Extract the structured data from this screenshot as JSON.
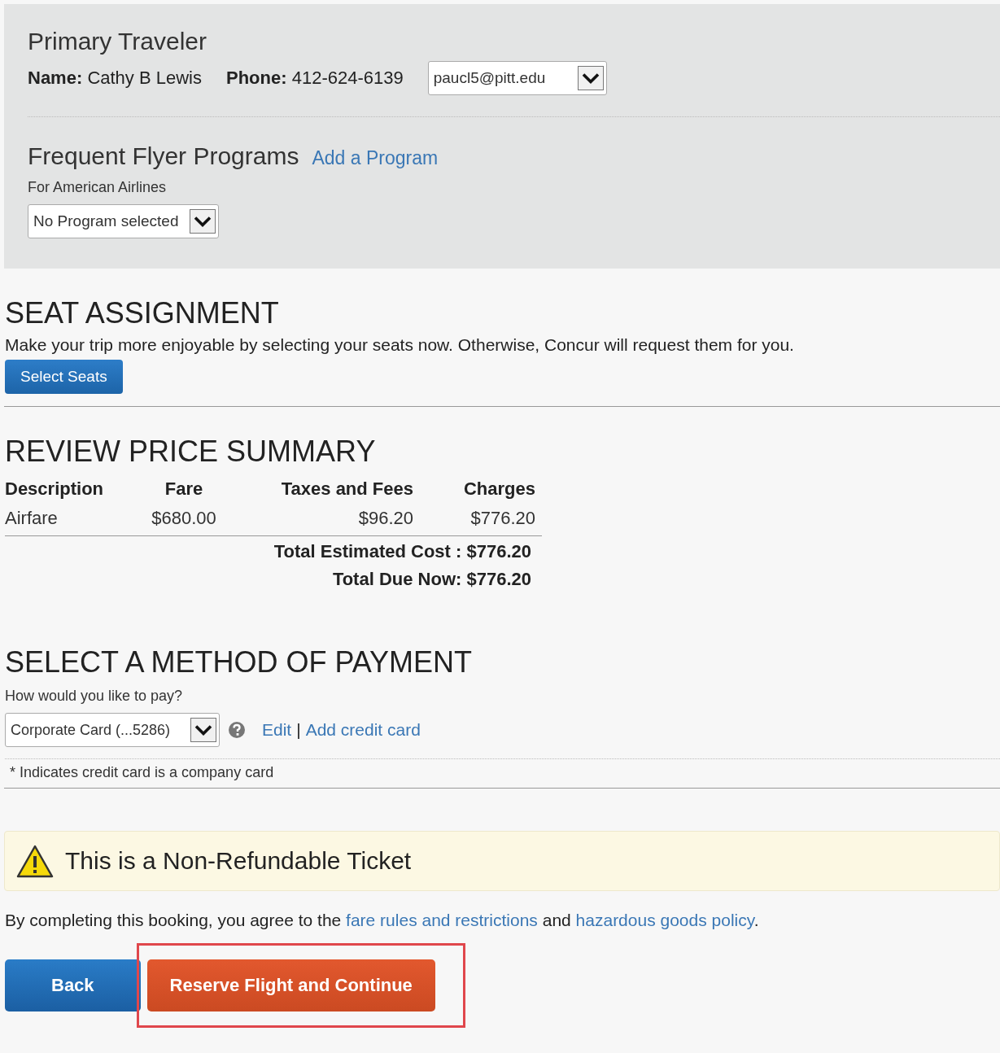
{
  "primary_traveler": {
    "title": "Primary Traveler",
    "name_label": "Name:",
    "name": "Cathy B Lewis",
    "phone_label": "Phone:",
    "phone": "412-624-6139",
    "email_select": {
      "value": "paucl5@pitt.edu"
    }
  },
  "frequent_flyer": {
    "title": "Frequent Flyer Programs",
    "add_link": "Add a Program",
    "label": "For American Airlines",
    "program_select": {
      "value": "No Program selected"
    }
  },
  "seat_assignment": {
    "title": "SEAT ASSIGNMENT",
    "text": "Make your trip more enjoyable by selecting your seats now.  Otherwise, Concur will request them for you.",
    "button": "Select Seats"
  },
  "price_summary": {
    "title": "REVIEW PRICE SUMMARY",
    "columns": [
      "Description",
      "Fare",
      "Taxes and Fees",
      "Charges"
    ],
    "rows": [
      [
        "Airfare",
        "$680.00",
        "$96.20",
        "$776.20"
      ]
    ],
    "totals": [
      {
        "label": "Total Estimated Cost :",
        "value": "$776.20"
      },
      {
        "label": "Total Due Now:",
        "value": "$776.20"
      }
    ]
  },
  "payment": {
    "title": "SELECT A METHOD OF PAYMENT",
    "question": "How would you like to pay?",
    "card_select": {
      "value": "Corporate Card (...5286)"
    },
    "edit_link": "Edit",
    "separator": "|",
    "add_link": "Add credit card",
    "note": "* Indicates credit card is a company card"
  },
  "warning": {
    "text": "This is a Non-Refundable Ticket"
  },
  "agreement": [
    {
      "kind": "text",
      "text": "By completing this booking, you agree to the "
    },
    {
      "kind": "link",
      "text": "fare rules and restrictions"
    },
    {
      "kind": "text",
      "text": " and "
    },
    {
      "kind": "link",
      "text": "hazardous goods policy"
    },
    {
      "kind": "text",
      "text": "."
    }
  ],
  "buttons": [
    {
      "label": "Back",
      "kind": "secondary",
      "highlighted": false
    },
    {
      "label": "Reserve Flight and Continue",
      "kind": "primary",
      "highlighted": true
    }
  ]
}
